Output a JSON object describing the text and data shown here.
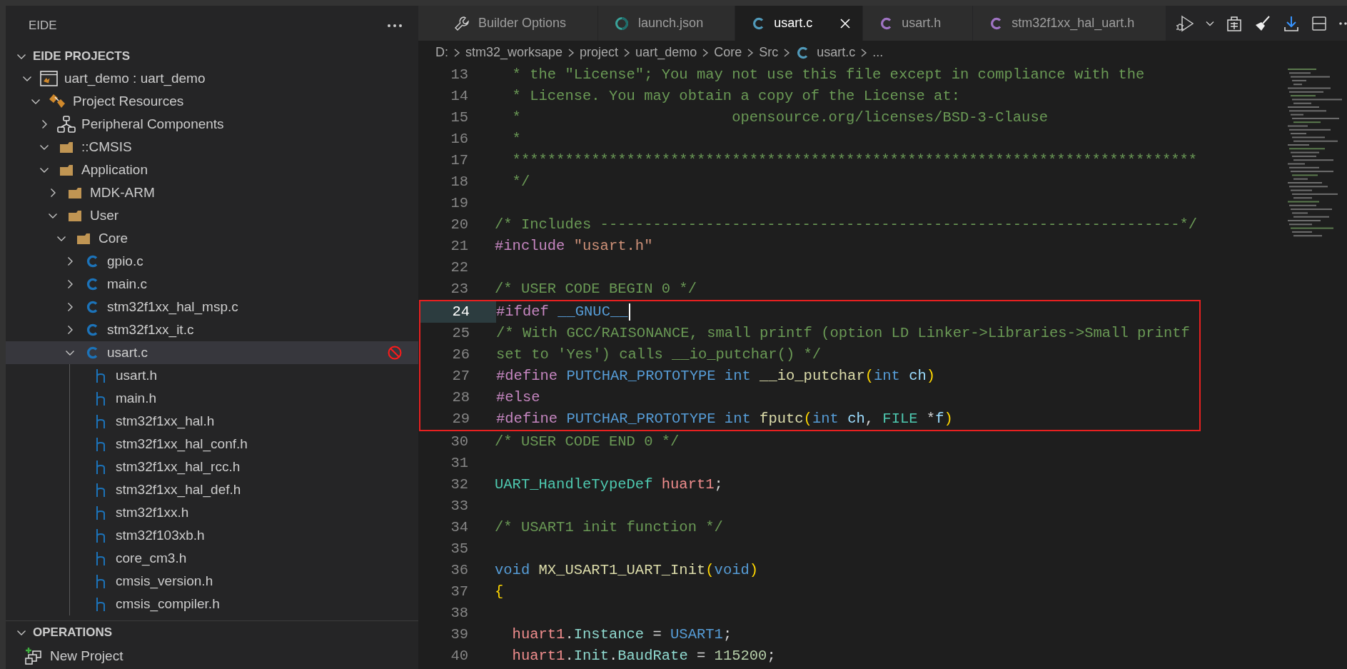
{
  "sidebar": {
    "title": "EIDE",
    "sections": [
      {
        "title": "EIDE PROJECTS",
        "expanded": true,
        "tree": [
          {
            "label": "uart_demo : uart_demo",
            "kind": "project",
            "expanded": true,
            "selected": false,
            "excluded": false,
            "children": [
              {
                "label": "Project Resources",
                "kind": "resources",
                "expanded": true,
                "selected": false,
                "excluded": false,
                "children": [
                  {
                    "label": "Peripheral Components",
                    "kind": "components",
                    "expanded": false,
                    "selected": false,
                    "excluded": false
                  },
                  {
                    "label": "::CMSIS",
                    "kind": "folder",
                    "expanded": true,
                    "selected": false,
                    "excluded": false
                  },
                  {
                    "label": "Application",
                    "kind": "folder",
                    "expanded": true,
                    "selected": false,
                    "excluded": false,
                    "children": [
                      {
                        "label": "MDK-ARM",
                        "kind": "folder",
                        "expanded": false,
                        "selected": false,
                        "excluded": false
                      },
                      {
                        "label": "User",
                        "kind": "folder",
                        "expanded": true,
                        "selected": false,
                        "excluded": false,
                        "children": [
                          {
                            "label": "Core",
                            "kind": "folder",
                            "expanded": true,
                            "selected": false,
                            "excluded": false,
                            "children": [
                              {
                                "label": "gpio.c",
                                "kind": "c",
                                "expanded": false,
                                "selected": false,
                                "excluded": false
                              },
                              {
                                "label": "main.c",
                                "kind": "c",
                                "expanded": false,
                                "selected": false,
                                "excluded": false
                              },
                              {
                                "label": "stm32f1xx_hal_msp.c",
                                "kind": "c",
                                "expanded": false,
                                "selected": false,
                                "excluded": false
                              },
                              {
                                "label": "stm32f1xx_it.c",
                                "kind": "c",
                                "expanded": false,
                                "selected": false,
                                "excluded": false
                              },
                              {
                                "label": "usart.c",
                                "kind": "c",
                                "expanded": true,
                                "selected": true,
                                "excluded": true,
                                "children": [
                                  {
                                    "label": "usart.h",
                                    "kind": "h",
                                    "selected": false,
                                    "excluded": false
                                  },
                                  {
                                    "label": "main.h",
                                    "kind": "h",
                                    "selected": false,
                                    "excluded": false
                                  },
                                  {
                                    "label": "stm32f1xx_hal.h",
                                    "kind": "h",
                                    "selected": false,
                                    "excluded": false
                                  },
                                  {
                                    "label": "stm32f1xx_hal_conf.h",
                                    "kind": "h",
                                    "selected": false,
                                    "excluded": false
                                  },
                                  {
                                    "label": "stm32f1xx_hal_rcc.h",
                                    "kind": "h",
                                    "selected": false,
                                    "excluded": false
                                  },
                                  {
                                    "label": "stm32f1xx_hal_def.h",
                                    "kind": "h",
                                    "selected": false,
                                    "excluded": false
                                  },
                                  {
                                    "label": "stm32f1xx.h",
                                    "kind": "h",
                                    "selected": false,
                                    "excluded": false
                                  },
                                  {
                                    "label": "stm32f103xb.h",
                                    "kind": "h",
                                    "selected": false,
                                    "excluded": false
                                  },
                                  {
                                    "label": "core_cm3.h",
                                    "kind": "h",
                                    "selected": false,
                                    "excluded": false
                                  },
                                  {
                                    "label": "cmsis_version.h",
                                    "kind": "h",
                                    "selected": false,
                                    "excluded": false
                                  },
                                  {
                                    "label": "cmsis_compiler.h",
                                    "kind": "h",
                                    "selected": false,
                                    "excluded": false
                                  }
                                ]
                              }
                            ]
                          }
                        ]
                      }
                    ]
                  }
                ]
              }
            ]
          }
        ]
      },
      {
        "title": "OPERATIONS",
        "expanded": true,
        "items": [
          {
            "label": "New Project",
            "kind": "add-project"
          }
        ]
      }
    ]
  },
  "tabs": [
    {
      "label": "Builder Options",
      "kind": "wrench",
      "selected": false
    },
    {
      "label": "launch.json",
      "kind": "json",
      "selected": false
    },
    {
      "label": "usart.c",
      "kind": "c",
      "selected": true
    },
    {
      "label": "usart.h",
      "kind": "h",
      "selected": false
    },
    {
      "label": "stm32f1xx_hal_uart.h",
      "kind": "h",
      "selected": false
    }
  ],
  "breadcrumb": [
    {
      "label": "D:"
    },
    {
      "label": "stm32_worksape"
    },
    {
      "label": "project"
    },
    {
      "label": "uart_demo"
    },
    {
      "label": "Core"
    },
    {
      "label": "Src"
    },
    {
      "label": "usart.c",
      "kind": "c"
    },
    {
      "label": "..."
    }
  ],
  "code": {
    "blocks": [
      {
        "boxed": false,
        "lines": [
          {
            "number": "13",
            "current": false,
            "tokens": [
              {
                "kind": "comment",
                "text": "  * the \"License\"; You may not use this file except in compliance with the"
              }
            ]
          },
          {
            "number": "14",
            "current": false,
            "tokens": [
              {
                "kind": "comment",
                "text": "  * License. You may obtain a copy of the License at:"
              }
            ]
          },
          {
            "number": "15",
            "current": false,
            "tokens": [
              {
                "kind": "comment",
                "text": "  *                        opensource.org/licenses/BSD-3-Clause"
              }
            ]
          },
          {
            "number": "16",
            "current": false,
            "tokens": [
              {
                "kind": "comment",
                "text": "  *"
              }
            ]
          },
          {
            "number": "17",
            "current": false,
            "tokens": [
              {
                "kind": "comment",
                "text": "  ******************************************************************************"
              }
            ]
          },
          {
            "number": "18",
            "current": false,
            "tokens": [
              {
                "kind": "comment",
                "text": "  */"
              }
            ]
          },
          {
            "number": "19",
            "current": false
          },
          {
            "number": "20",
            "current": false,
            "tokens": [
              {
                "kind": "comment",
                "text": "/* Includes ------------------------------------------------------------------*/"
              }
            ]
          },
          {
            "number": "21",
            "current": false,
            "tokens": [
              {
                "kind": "preproc",
                "text": "#include "
              },
              {
                "kind": "string",
                "text": "\"usart.h\""
              }
            ]
          },
          {
            "number": "22",
            "current": false
          },
          {
            "number": "23",
            "current": false,
            "tokens": [
              {
                "kind": "comment",
                "text": "/* USER CODE BEGIN 0 */"
              }
            ]
          }
        ]
      },
      {
        "boxed": true,
        "lines": [
          {
            "number": "24",
            "current": true,
            "tokens": [
              {
                "kind": "preproc",
                "text": "#ifdef "
              },
              {
                "kind": "macro",
                "text": "__GNUC__"
              }
            ]
          },
          {
            "number": "25",
            "current": false,
            "tokens": [
              {
                "kind": "comment",
                "text": "/* With GCC/RAISONANCE, small printf (option LD Linker->Libraries->Small printf"
              }
            ]
          },
          {
            "number": "26",
            "current": false,
            "tokens": [
              {
                "kind": "comment",
                "text": "set to 'Yes') calls __io_putchar() */"
              }
            ]
          },
          {
            "number": "27",
            "current": false,
            "tokens": [
              {
                "kind": "preproc",
                "text": "#define "
              },
              {
                "kind": "macro",
                "text": "PUTCHAR_PROTOTYPE "
              },
              {
                "kind": "keyword",
                "text": "int "
              },
              {
                "kind": "func",
                "text": "__io_putchar"
              },
              {
                "kind": "bracket",
                "text": "("
              },
              {
                "kind": "keyword",
                "text": "int "
              },
              {
                "kind": "param",
                "text": "ch"
              },
              {
                "kind": "bracket",
                "text": ")"
              }
            ]
          },
          {
            "number": "28",
            "current": false,
            "tokens": [
              {
                "kind": "preproc",
                "text": "#else"
              }
            ]
          },
          {
            "number": "29",
            "current": false,
            "tokens": [
              {
                "kind": "preproc",
                "text": "#define "
              },
              {
                "kind": "macro",
                "text": "PUTCHAR_PROTOTYPE "
              },
              {
                "kind": "keyword",
                "text": "int "
              },
              {
                "kind": "func",
                "text": "fputc"
              },
              {
                "kind": "bracket",
                "text": "("
              },
              {
                "kind": "keyword",
                "text": "int "
              },
              {
                "kind": "param",
                "text": "ch"
              },
              {
                "kind": "plain",
                "text": ", "
              },
              {
                "kind": "type",
                "text": "FILE "
              },
              {
                "kind": "plain",
                "text": "*"
              },
              {
                "kind": "param",
                "text": "f"
              },
              {
                "kind": "bracket",
                "text": ")"
              }
            ]
          }
        ]
      },
      {
        "boxed": false,
        "lines": [
          {
            "number": "30",
            "current": false,
            "tokens": [
              {
                "kind": "comment",
                "text": "/* USER CODE END 0 */"
              }
            ]
          },
          {
            "number": "31",
            "current": false
          },
          {
            "number": "32",
            "current": false,
            "tokens": [
              {
                "kind": "type",
                "text": "UART_HandleTypeDef "
              },
              {
                "kind": "var",
                "text": "huart1"
              },
              {
                "kind": "plain",
                "text": ";"
              }
            ]
          },
          {
            "number": "33",
            "current": false
          },
          {
            "number": "34",
            "current": false,
            "tokens": [
              {
                "kind": "comment",
                "text": "/* USART1 init function */"
              }
            ]
          },
          {
            "number": "35",
            "current": false
          },
          {
            "number": "36",
            "current": false,
            "tokens": [
              {
                "kind": "keyword",
                "text": "void "
              },
              {
                "kind": "func",
                "text": "MX_USART1_UART_Init"
              },
              {
                "kind": "bracket",
                "text": "("
              },
              {
                "kind": "keyword",
                "text": "void"
              },
              {
                "kind": "bracket",
                "text": ")"
              }
            ]
          },
          {
            "number": "37",
            "current": false,
            "tokens": [
              {
                "kind": "bracket",
                "text": "{"
              }
            ]
          },
          {
            "number": "38",
            "current": false
          },
          {
            "number": "39",
            "current": false,
            "tokens": [
              {
                "kind": "var",
                "text": "  huart1"
              },
              {
                "kind": "plain",
                "text": "."
              },
              {
                "kind": "prop",
                "text": "Instance"
              },
              {
                "kind": "plain",
                "text": " = "
              },
              {
                "kind": "macro",
                "text": "USART1"
              },
              {
                "kind": "plain",
                "text": ";"
              }
            ]
          },
          {
            "number": "40",
            "current": false,
            "tokens": [
              {
                "kind": "var",
                "text": "  huart1"
              },
              {
                "kind": "plain",
                "text": "."
              },
              {
                "kind": "prop",
                "text": "Init"
              },
              {
                "kind": "plain",
                "text": "."
              },
              {
                "kind": "prop",
                "text": "BaudRate"
              },
              {
                "kind": "plain",
                "text": " = "
              },
              {
                "kind": "num",
                "text": "115200"
              },
              {
                "kind": "plain",
                "text": ";"
              }
            ]
          }
        ]
      }
    ]
  }
}
